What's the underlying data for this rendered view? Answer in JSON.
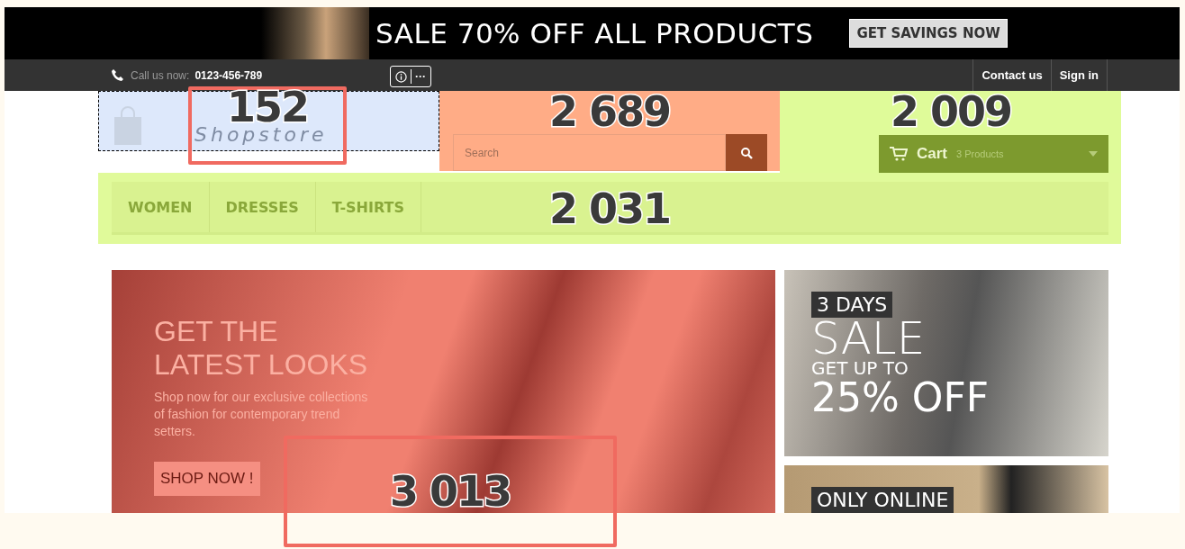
{
  "top_banner": {
    "headline": "SALE 70% OFF ALL PRODUCTS",
    "button": "GET SAVINGS NOW"
  },
  "nav_bar": {
    "call_label": "Call us now:",
    "phone": "0123-456-789",
    "links": [
      "Contact us",
      "Sign in"
    ]
  },
  "toolbar": {
    "more": "···"
  },
  "header": {
    "logo": "Shopstore",
    "search_placeholder": "Search",
    "cart_label": "Cart",
    "cart_count": "3 Products"
  },
  "menu": [
    "WOMEN",
    "DRESSES",
    "T-SHIRTS"
  ],
  "hero": {
    "title_lines": [
      "GET THE",
      "LATEST LOOKS"
    ],
    "text": "Shop now for our exclusive collections of fashion for contemporary trend setters.",
    "button": "SHOP NOW !"
  },
  "side_banners": [
    {
      "tag": "3 DAYS",
      "lines": [
        "SALE",
        "GET UP TO",
        "25% OFF"
      ]
    },
    {
      "tag": "ONLY ONLINE"
    }
  ],
  "heatmap": {
    "zones": [
      {
        "count": "152",
        "color": "#dde8fb",
        "selected": true,
        "focused": true
      },
      {
        "count": "2 689",
        "color": "#ffac86",
        "selected": false,
        "focused": false
      },
      {
        "count": "2 009",
        "color": "#dffb99",
        "selected": false,
        "focused": false
      },
      {
        "count": "2 031",
        "color": "#e0fa9a",
        "selected": false,
        "focused": false
      },
      {
        "count": "3 013",
        "color": "#f08070",
        "selected": true,
        "focused": false
      }
    ]
  }
}
